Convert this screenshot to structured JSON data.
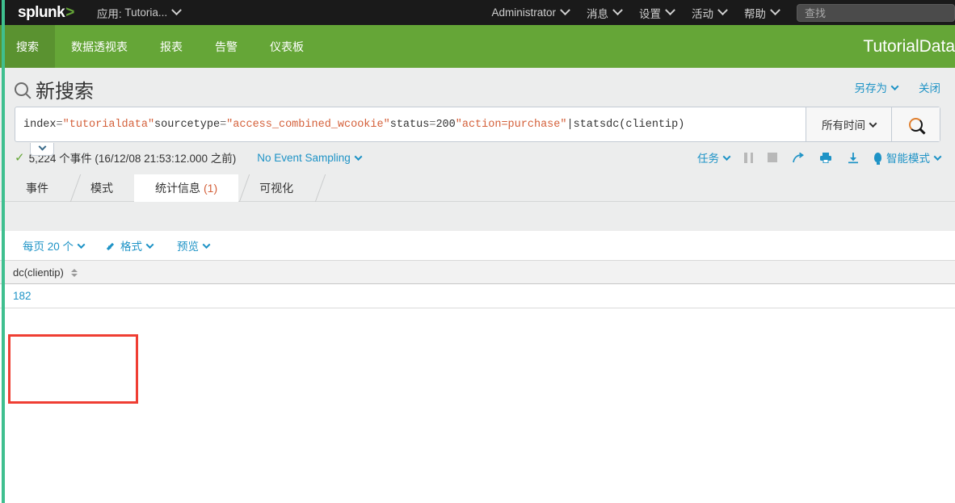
{
  "topbar": {
    "logo": "splunk",
    "logo_mark": ">",
    "app_context_label": "应用:",
    "app_context_value": "Tutoria...",
    "items": [
      {
        "label": "Administrator",
        "caret": true
      },
      {
        "label": "消息",
        "caret": true
      },
      {
        "label": "设置",
        "caret": true
      },
      {
        "label": "活动",
        "caret": true
      },
      {
        "label": "帮助",
        "caret": true
      }
    ],
    "search_placeholder": "查找"
  },
  "appnav": {
    "items": [
      {
        "label": "搜索",
        "active": true
      },
      {
        "label": "数据透视表",
        "active": false
      },
      {
        "label": "报表",
        "active": false
      },
      {
        "label": "告警",
        "active": false
      },
      {
        "label": "仪表板",
        "active": false
      }
    ],
    "app_title": "TutorialData"
  },
  "page": {
    "title": "新搜索",
    "save_as_label": "另存为",
    "close_label": "关闭"
  },
  "search": {
    "query_full": "index=\"tutorialdata\"  sourcetype=\"access_combined_wcookie\" status=200 \"action=purchase\" |stats dc(clientip)",
    "tokens": [
      {
        "text": "index",
        "kind": "plain"
      },
      {
        "text": "=",
        "kind": "op"
      },
      {
        "text": "\"tutorialdata\"",
        "kind": "str"
      },
      {
        "text": "  ",
        "kind": "plain"
      },
      {
        "text": "sourcetype",
        "kind": "plain"
      },
      {
        "text": "=",
        "kind": "op"
      },
      {
        "text": "\"access_combined_wcookie\"",
        "kind": "str"
      },
      {
        "text": " ",
        "kind": "plain"
      },
      {
        "text": "status",
        "kind": "plain"
      },
      {
        "text": "=",
        "kind": "op"
      },
      {
        "text": "200",
        "kind": "plain"
      },
      {
        "text": " ",
        "kind": "plain"
      },
      {
        "text": "\"action=purchase\"",
        "kind": "str"
      },
      {
        "text": " |",
        "kind": "plain"
      },
      {
        "text": "stats",
        "kind": "plain"
      },
      {
        "text": " dc(clientip)",
        "kind": "plain"
      }
    ],
    "time_range": "所有时间"
  },
  "jobbar": {
    "events_text": "5,224 个事件 (16/12/08 21:53:12.000 之前)",
    "sampling_label": "No Event Sampling",
    "job_label": "任务",
    "mode_label": "智能模式"
  },
  "tabs": [
    {
      "label": "事件",
      "count": "",
      "active": false
    },
    {
      "label": "模式",
      "count": "",
      "active": false
    },
    {
      "label": "统计信息",
      "count": "(1)",
      "active": true
    },
    {
      "label": "可视化",
      "count": "",
      "active": false
    }
  ],
  "results_toolbar": {
    "per_page_label": "每页 20 个",
    "format_label": "格式",
    "preview_label": "预览"
  },
  "table": {
    "columns": [
      "dc(clientip)"
    ],
    "rows": [
      [
        "182"
      ]
    ]
  },
  "colors": {
    "brand_green": "#65a637",
    "link_blue": "#1e93c6",
    "string_orange": "#d4603a",
    "annotation_red": "#ef3e33",
    "topbar_black": "#1a1a1a",
    "rail_green": "#3fbf8f"
  }
}
